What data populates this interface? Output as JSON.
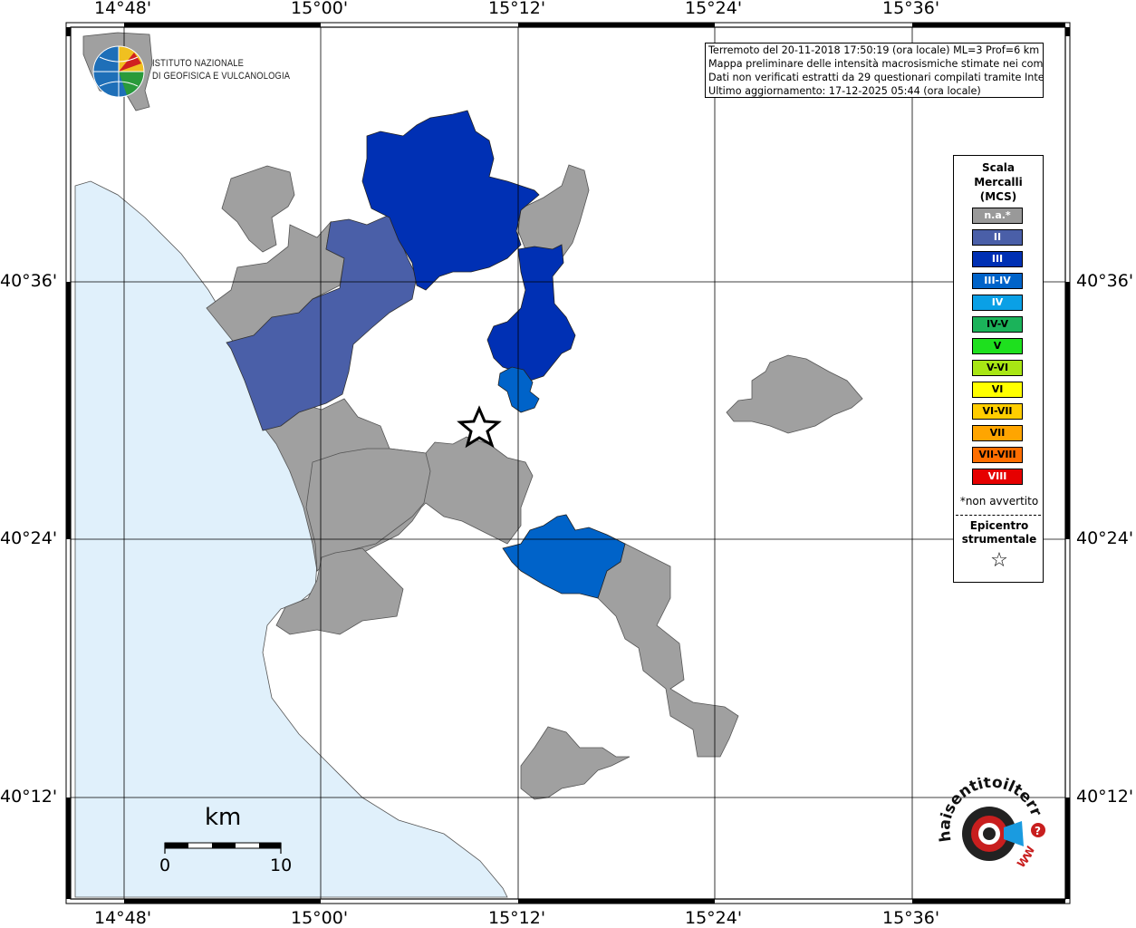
{
  "coords": {
    "lon_labels": [
      "14°48'",
      "15°00'",
      "15°12'",
      "15°24'",
      "15°36'"
    ],
    "lat_labels": [
      "40°36'",
      "40°24'",
      "40°12'"
    ]
  },
  "info": {
    "line1": "Terremoto del 20-11-2018 17:50:19 (ora locale) ML=3 Prof=6 km",
    "line2": "Mappa preliminare delle intensità macrosismiche stimate nei comuni",
    "line3": "Dati non verificati estratti da 29 questionari compilati tramite Internet.",
    "line4": "Ultimo aggiornamento: 17-12-2025 05:44 (ora locale)"
  },
  "logo": {
    "line1": "ISTITUTO NAZIONALE",
    "line2": "DI GEOFISICA E VULCANOLOGIA"
  },
  "legend": {
    "title1": "Scala",
    "title2": "Mercalli",
    "title3": "(MCS)",
    "items": [
      {
        "label": "n.a.*",
        "color": "#999999"
      },
      {
        "label": "II",
        "color": "#4a5fa8"
      },
      {
        "label": "III",
        "color": "#0030b4"
      },
      {
        "label": "III-IV",
        "color": "#0063c9"
      },
      {
        "label": "IV",
        "color": "#0aa0e6"
      },
      {
        "label": "IV-V",
        "color": "#1bb35a"
      },
      {
        "label": "V",
        "color": "#1ee01e"
      },
      {
        "label": "V-VI",
        "color": "#a8e614"
      },
      {
        "label": "VI",
        "color": "#ffff00"
      },
      {
        "label": "VI-VII",
        "color": "#ffcd00"
      },
      {
        "label": "VII",
        "color": "#ffa500"
      },
      {
        "label": "VII-VIII",
        "color": "#ff6e00"
      },
      {
        "label": "VIII",
        "color": "#e60000"
      }
    ],
    "note": "*non avvertito",
    "epicentro1": "Epicentro",
    "epicentro2": "strumentale",
    "star": "☆"
  },
  "scale": {
    "unit": "km",
    "min": "0",
    "max": "10"
  },
  "brand": {
    "text": "haisentitoilterremoto.it",
    "url": "WWW.",
    "question": "?"
  },
  "colors": {
    "sea": "#e0f0fb",
    "na": "#a0a0a0",
    "ii": "#4a5fa8",
    "iii": "#0030b4",
    "iii_iv": "#0063c9"
  }
}
